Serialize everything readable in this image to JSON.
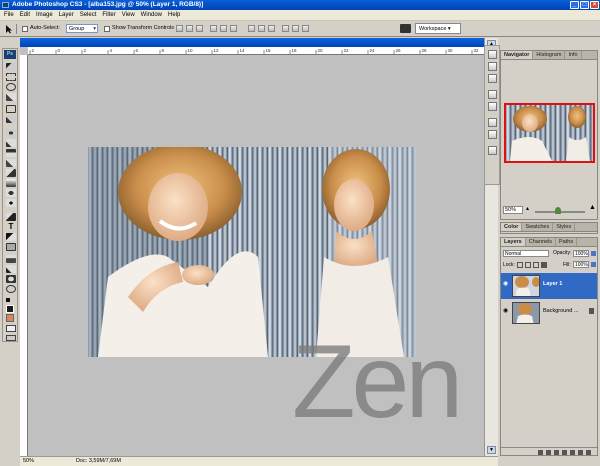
{
  "window": {
    "title": "Adobe Photoshop CS3 - [alba153.jpg @ 50% (Layer 1, RGB/8)]",
    "minimize": "_",
    "maximize": "□",
    "close": "×"
  },
  "menu": [
    "File",
    "Edit",
    "Image",
    "Layer",
    "Select",
    "Filter",
    "View",
    "Window",
    "Help"
  ],
  "options": {
    "auto_select_label": "Auto-Select:",
    "auto_select_value": "Group",
    "transform_label": "Show Transform Controls",
    "workspace_label": "Workspace ▾"
  },
  "toolbox": {
    "logo": "Ps",
    "foreground_color": "#1a1a1a",
    "background_color": "#d9875a"
  },
  "ruler": {
    "ticks": [
      "2",
      "0",
      "2",
      "4",
      "6",
      "8",
      "10",
      "12",
      "14",
      "16",
      "18",
      "20",
      "22",
      "24",
      "26",
      "28",
      "30",
      "32"
    ]
  },
  "document": {
    "watermark": "Zen",
    "canvas_bg": "#c0c0c0"
  },
  "status": {
    "zoom": "50%",
    "doc": "Doc: 3,59M/7,69M"
  },
  "navigator": {
    "tabs": [
      "Navigator",
      "Histogram",
      "Info"
    ],
    "zoom": "50%",
    "zoom_level": 0.45
  },
  "color_panel": {
    "tabs": [
      "Color",
      "Swatches",
      "Styles"
    ]
  },
  "layers": {
    "tabs": [
      "Layers",
      "Channels",
      "Paths"
    ],
    "blend_mode": "Normal",
    "opacity_label": "Opacity:",
    "opacity": "100%",
    "lock_label": "Lock:",
    "fill_label": "Fill:",
    "fill": "100%",
    "items": [
      {
        "name": "Layer 1",
        "selected": true
      },
      {
        "name": "Background ...",
        "selected": false
      }
    ]
  }
}
